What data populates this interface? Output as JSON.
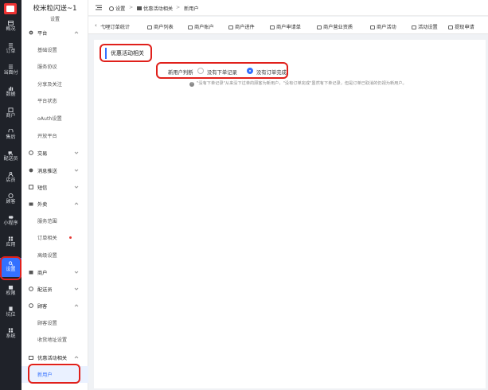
{
  "rail": {
    "items": [
      {
        "label": "概况",
        "icon": "overview-icon"
      },
      {
        "label": "订单",
        "icon": "order-icon"
      },
      {
        "label": "当面付",
        "icon": "pay-icon"
      },
      {
        "label": "数据",
        "icon": "data-icon"
      },
      {
        "label": "商户",
        "icon": "merchant-icon"
      },
      {
        "label": "售后",
        "icon": "aftersale-icon"
      },
      {
        "label": "配送员",
        "icon": "courier-icon"
      },
      {
        "label": "店员",
        "icon": "staff-icon"
      },
      {
        "label": "顾客",
        "icon": "customer-icon"
      },
      {
        "label": "小程序",
        "icon": "miniapp-icon"
      },
      {
        "label": "应用",
        "icon": "apps-icon"
      },
      {
        "label": "设置",
        "icon": "settings-icon"
      },
      {
        "label": "权限",
        "icon": "permission-icon"
      },
      {
        "label": "坑位",
        "icon": "slot-icon"
      },
      {
        "label": "系统",
        "icon": "system-icon"
      }
    ]
  },
  "sidebar": {
    "title": "校米粒闪送~1",
    "subtitle": "设置",
    "platform": {
      "label": "平台",
      "items": [
        "基础设置",
        "服务协议",
        "分享及关注",
        "平台状态",
        "oAuth设置",
        "开放平台"
      ]
    },
    "groups_a": [
      {
        "label": "交易"
      },
      {
        "label": "消息推送"
      },
      {
        "label": "短信"
      }
    ],
    "takeout": {
      "label": "外卖",
      "items": [
        "服务范围",
        "订单相关",
        "高级设置"
      ]
    },
    "groups_b": [
      {
        "label": "商户"
      },
      {
        "label": "配送员"
      }
    ],
    "customer": {
      "label": "顾客",
      "items": [
        "顾客设置",
        "收货地址设置"
      ]
    },
    "promo": {
      "label": "优惠活动相关",
      "items": [
        "新用户"
      ]
    }
  },
  "topbar": {
    "crumbs": [
      "设置",
      ">",
      "优惠活动相关",
      ">",
      "新用户"
    ]
  },
  "tabs": [
    "弋哩订单统计",
    "商户列表",
    "商户账户",
    "商户进件",
    "商户申请单",
    "商户营业资质",
    "商户活动",
    "活动设置",
    "提现申请"
  ],
  "content": {
    "section_title": "优惠活动相关",
    "field_label": "新用户判断",
    "options": [
      "没有下单记录",
      "没有订单完成"
    ],
    "selected": "没有订单完成",
    "hint": "\"没有下单记录\"从来没下过单的顾客为新用户，\"没有订单完成\"虽然有下单记录，但是订单已取消的仍视为新用户。"
  },
  "colors": {
    "accent": "#3370ff",
    "annotation": "#e0201b",
    "rail": "#1f2229"
  }
}
